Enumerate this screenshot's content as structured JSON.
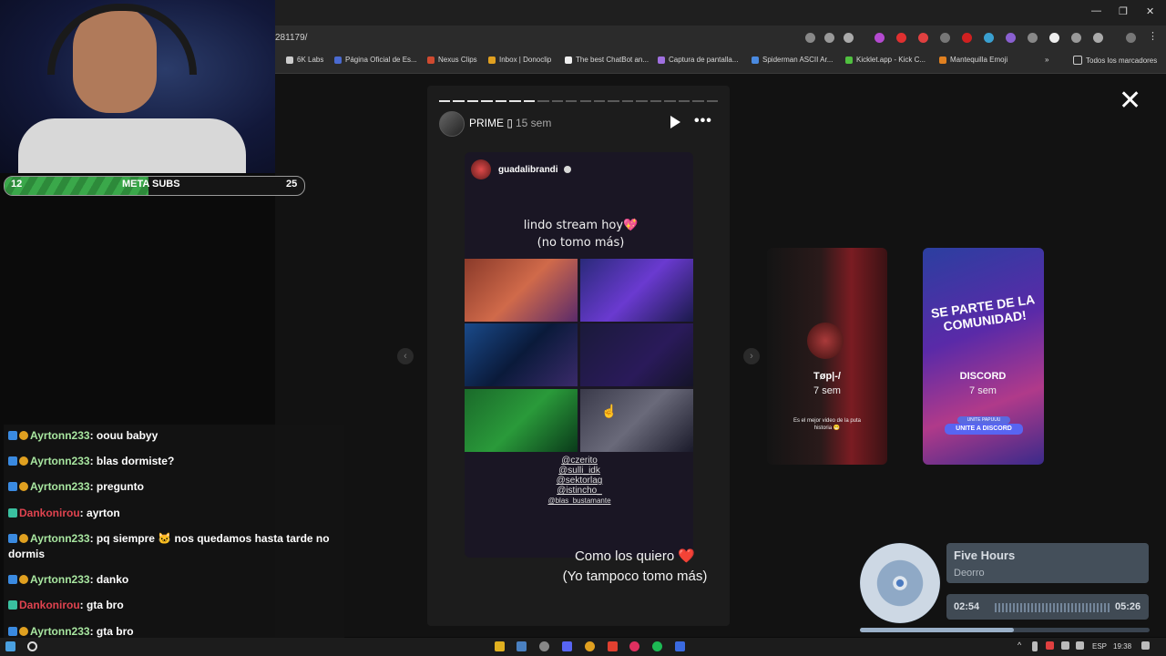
{
  "browser": {
    "url": "281179/",
    "bookmarks": [
      "6K Labs",
      "Página Oficial de Es...",
      "Nexus Clips",
      "Inbox | Donoclip",
      "The best ChatBot an...",
      "Captura de pantalla...",
      "Spiderman ASCII Ar...",
      "Kicklet.app - Kick C...",
      "Mantequilla Emoji"
    ],
    "bookmarks_folder": "Todos los marcadores"
  },
  "story": {
    "user": "PRIME ▯",
    "time": "15 sem",
    "progress_segments": 20,
    "progress_done": 7,
    "inner_user": "guadalibrandi",
    "inner_text_line1": "lindo stream hoy💖",
    "inner_text_line2": "(no tomo más)",
    "mentions": [
      "@czerito",
      "@sulli_idk",
      "@sektorlag",
      "@istincho_",
      "@blas_bustamante"
    ],
    "caption_line1": "Como los quiero ❤️",
    "caption_line2": "(Yo tampoco tomo más)"
  },
  "previews": [
    {
      "name": "Tøp|-/",
      "time": "7 sem",
      "subtext": "Es el mejor video de la puta historia 😁"
    },
    {
      "name": "DISCORD",
      "time": "7 sem",
      "banner": "SE PARTE DE LA COMUNIDAD!",
      "button": "UNITE A DISCORD",
      "button_small": "UNITE PAPUUU"
    }
  ],
  "meta": {
    "current": "12",
    "label": "META SUBS",
    "goal": "25",
    "progress": 0.48
  },
  "chat": [
    {
      "user": "Ayrtonn233",
      "text": "oouu babyy",
      "color": "#a8e6a0"
    },
    {
      "user": "Ayrtonn233",
      "text": "blas dormiste?",
      "color": "#a8e6a0"
    },
    {
      "user": "Ayrtonn233",
      "text": "pregunto",
      "color": "#a8e6a0"
    },
    {
      "user": "Dankonirou",
      "text": "ayrton",
      "color": "#e0434f"
    },
    {
      "user": "Ayrtonn233",
      "text": "pq siempre 🐱 nos quedamos hasta tarde no dormis",
      "color": "#a8e6a0"
    },
    {
      "user": "Ayrtonn233",
      "text": "danko",
      "color": "#a8e6a0"
    },
    {
      "user": "Dankonirou",
      "text": "gta bro",
      "color": "#e0434f"
    },
    {
      "user": "Ayrtonn233",
      "text": "gta bro",
      "color": "#a8e6a0"
    }
  ],
  "music": {
    "title": "Five Hours",
    "artist": "Deorro",
    "current": "02:54",
    "duration": "05:26",
    "progress": 0.53
  },
  "tray": {
    "lang": "ESP",
    "time": "19:38"
  }
}
